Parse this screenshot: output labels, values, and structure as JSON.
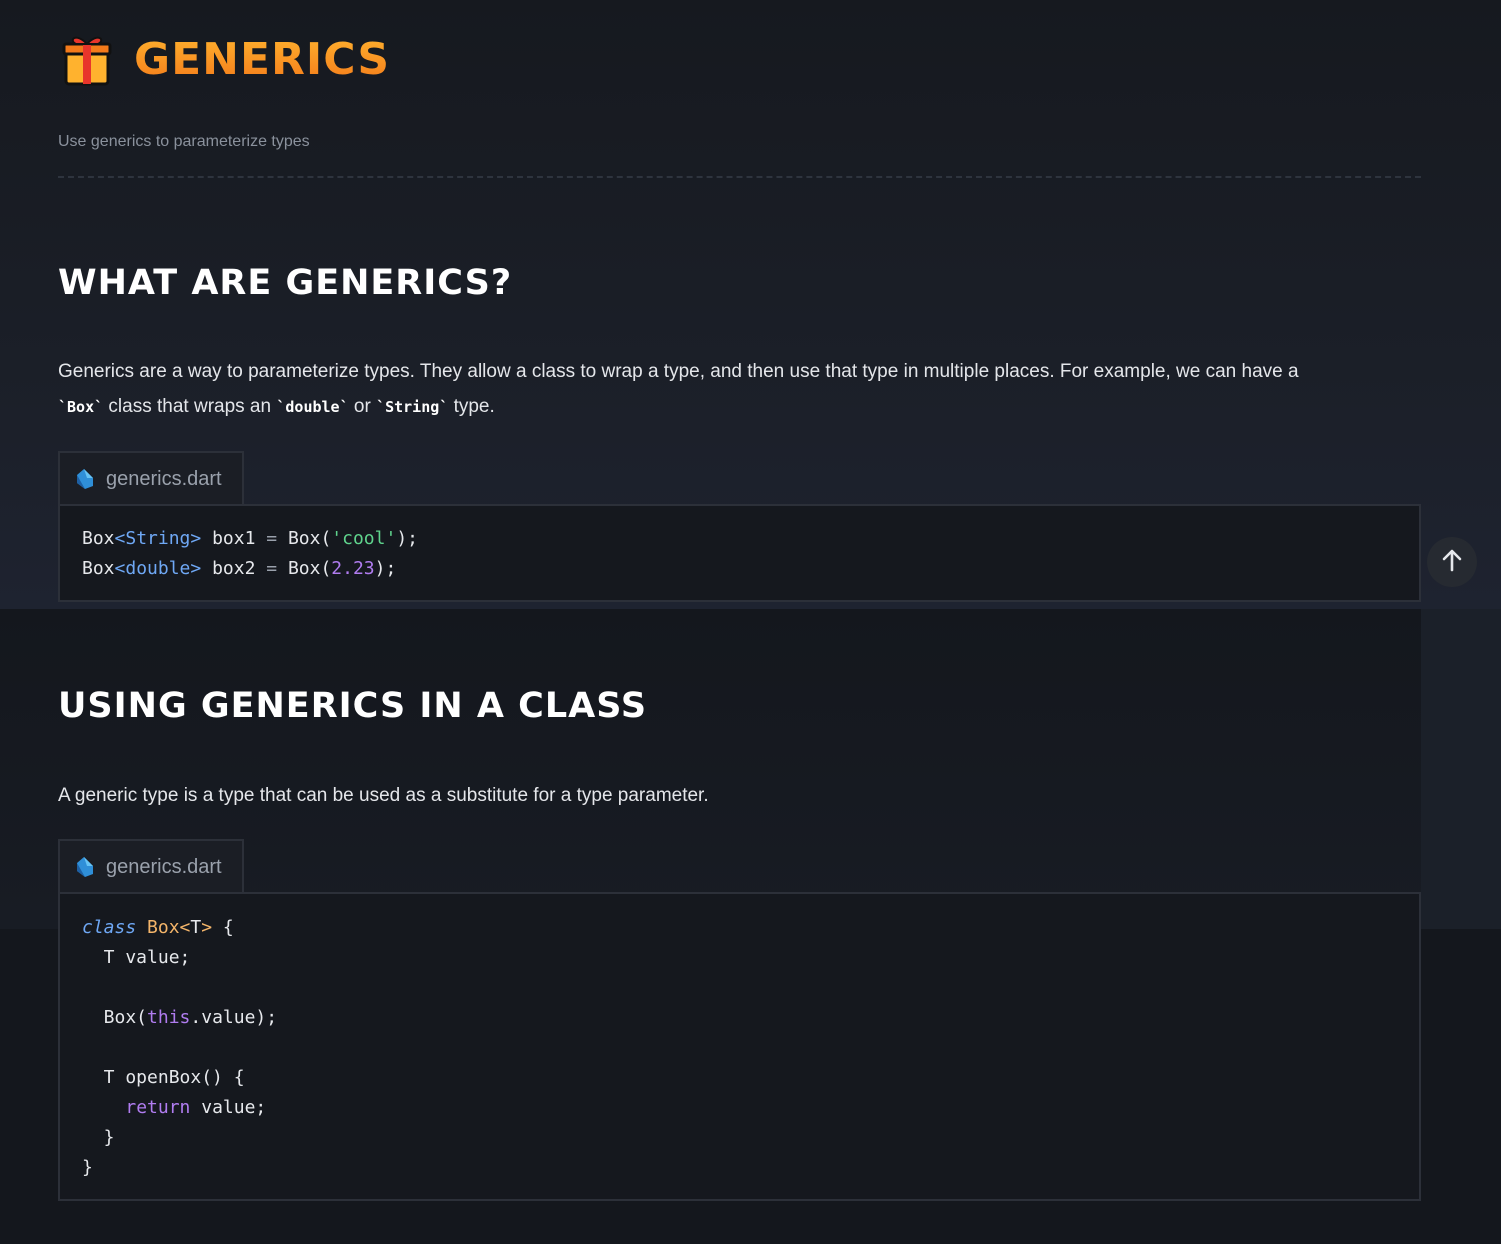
{
  "header": {
    "title": "GENERICS",
    "subtitle": "Use generics to parameterize types"
  },
  "sections": [
    {
      "heading": "WHAT ARE GENERICS?",
      "paragraph": {
        "line1": "Generics are a way to parameterize types. They allow a class to wrap a type, and then use that type in multiple places. For example, we can have a",
        "code1": "`Box`",
        "text2": " class that wraps an ",
        "code2": "`double`",
        "text3": " or ",
        "code3": "`String`",
        "text4": " type."
      },
      "file_tab": "generics.dart"
    },
    {
      "heading": "USING GENERICS IN A CLASS",
      "paragraph": "A generic type is a type that can be used as a substitute for a type parameter.",
      "file_tab": "generics.dart"
    }
  ],
  "code1": {
    "l1": [
      "Box",
      "<",
      "String",
      ">",
      " box1 ",
      "=",
      " Box(",
      "'cool'",
      ");"
    ],
    "l2": [
      "Box",
      "<",
      "double",
      ">",
      " box2 ",
      "=",
      " Box(",
      "2.23",
      ");"
    ]
  },
  "code2": {
    "kw_class": "class",
    "cls_name": "Box",
    "lt": "<",
    "tparam": "T",
    "gt": ">",
    "brace_open": " {",
    "line_field": "  T value;",
    "ctor_pre": "  Box(",
    "kw_this": "this",
    "ctor_post": ".value);",
    "method": "  T openBox() {",
    "ret_indent": "    ",
    "kw_return": "return",
    "ret_rest": " value;",
    "close_method": "  }",
    "close_class": "}"
  },
  "icons": {
    "gift": "gift-icon",
    "dart": "dart-logo-icon",
    "scroll_top": "arrow-up-icon"
  }
}
